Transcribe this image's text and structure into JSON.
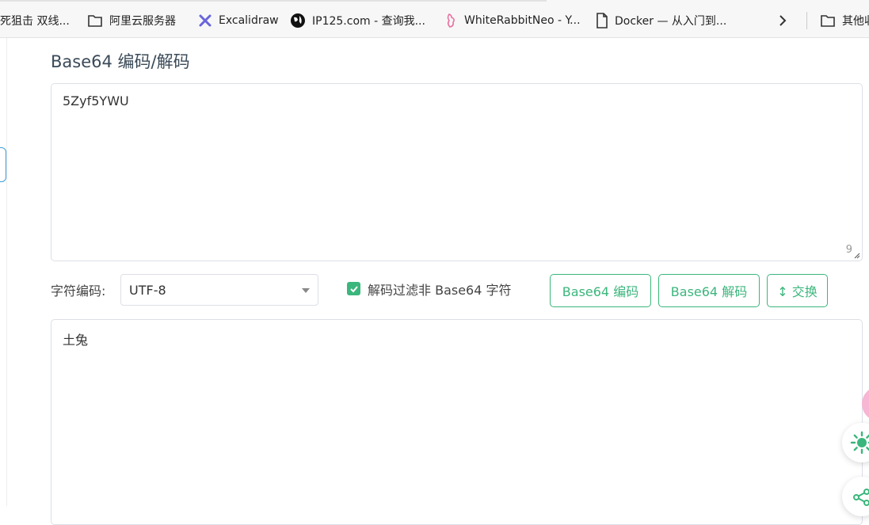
{
  "bookmarks": [
    {
      "label": "死狙击 双线..."
    },
    {
      "label": "阿里云服务器"
    },
    {
      "label": "Excalidraw"
    },
    {
      "label": "IP125.com - 查询我..."
    },
    {
      "label": "WhiteRabbitNeo - Y..."
    },
    {
      "label": "Docker — 从入门到..."
    },
    {
      "label": "其他收"
    }
  ],
  "page": {
    "title": "Base64 编码/解码",
    "input_value": "5Zyf5YWU",
    "input_count": "9",
    "output_value": "土兔"
  },
  "controls": {
    "encoding_label": "字符编码:",
    "encoding_value": "UTF-8",
    "filter_label": "解码过滤非 Base64 字符",
    "encode_button": "Base64 编码",
    "decode_button": "Base64 解码",
    "swap_button": "↕ 交换"
  },
  "colors": {
    "accent": "#3bb67c",
    "border": "#dcdfe6"
  }
}
